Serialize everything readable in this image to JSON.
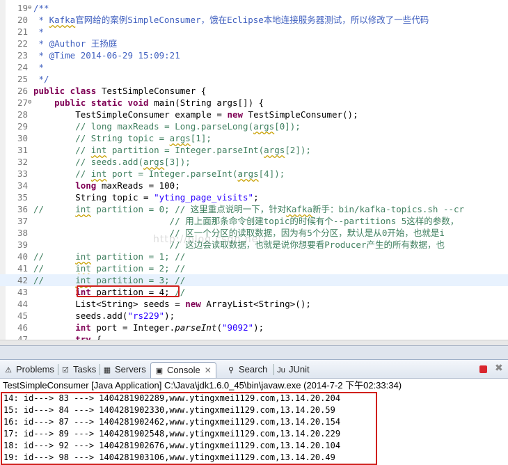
{
  "editor": {
    "lines": [
      {
        "n": "19",
        "marker": "⊖",
        "segs": [
          {
            "t": "/**",
            "c": "jd"
          }
        ]
      },
      {
        "n": "20",
        "segs": [
          {
            "t": " * ",
            "c": "jd"
          },
          {
            "t": "Kafka",
            "c": "jd sq"
          },
          {
            "t": "官网给的案例",
            "c": "jd cjk"
          },
          {
            "t": "SimpleConsumer",
            "c": "jd"
          },
          {
            "t": "，饿在",
            "c": "jd cjk"
          },
          {
            "t": "Eclipse",
            "c": "jd"
          },
          {
            "t": "本地连接服务器测试，所以修改了一些代码",
            "c": "jd cjk"
          }
        ]
      },
      {
        "n": "21",
        "segs": [
          {
            "t": " *",
            "c": "jd"
          }
        ]
      },
      {
        "n": "22",
        "segs": [
          {
            "t": " * @Author ",
            "c": "jd"
          },
          {
            "t": "王扬庭",
            "c": "jd cjk"
          }
        ]
      },
      {
        "n": "23",
        "segs": [
          {
            "t": " * @Time 2014-06-29 15:09:21",
            "c": "jd"
          }
        ]
      },
      {
        "n": "24",
        "segs": [
          {
            "t": " *",
            "c": "jd"
          }
        ]
      },
      {
        "n": "25",
        "segs": [
          {
            "t": " */",
            "c": "jd"
          }
        ]
      },
      {
        "n": "26",
        "segs": [
          {
            "t": "public class",
            "c": "kw"
          },
          {
            "t": " TestSimpleConsumer {",
            "c": ""
          }
        ]
      },
      {
        "n": "27",
        "marker": "⊖",
        "segs": [
          {
            "t": "    ",
            "c": ""
          },
          {
            "t": "public static void",
            "c": "kw"
          },
          {
            "t": " main(String args[]) {",
            "c": ""
          }
        ]
      },
      {
        "n": "28",
        "segs": [
          {
            "t": "        TestSimpleConsumer example = ",
            "c": ""
          },
          {
            "t": "new",
            "c": "kw"
          },
          {
            "t": " TestSimpleConsumer();",
            "c": ""
          }
        ]
      },
      {
        "n": "29",
        "segs": [
          {
            "t": "        // long maxReads = Long.parseLong(",
            "c": "cm"
          },
          {
            "t": "args",
            "c": "cm sq"
          },
          {
            "t": "[0]);",
            "c": "cm"
          }
        ]
      },
      {
        "n": "30",
        "segs": [
          {
            "t": "        // String topic = ",
            "c": "cm"
          },
          {
            "t": "args",
            "c": "cm sq"
          },
          {
            "t": "[1];",
            "c": "cm"
          }
        ]
      },
      {
        "n": "31",
        "segs": [
          {
            "t": "        // ",
            "c": "cm"
          },
          {
            "t": "int",
            "c": "cm sq"
          },
          {
            "t": " partition = Integer.parseInt(",
            "c": "cm"
          },
          {
            "t": "args",
            "c": "cm sq"
          },
          {
            "t": "[2]);",
            "c": "cm"
          }
        ]
      },
      {
        "n": "32",
        "segs": [
          {
            "t": "        // seeds.add(",
            "c": "cm"
          },
          {
            "t": "args",
            "c": "cm sq"
          },
          {
            "t": "[3]);",
            "c": "cm"
          }
        ]
      },
      {
        "n": "33",
        "segs": [
          {
            "t": "        // ",
            "c": "cm"
          },
          {
            "t": "int",
            "c": "cm sq"
          },
          {
            "t": " port = Integer.parseInt(",
            "c": "cm"
          },
          {
            "t": "args",
            "c": "cm sq"
          },
          {
            "t": "[4]);",
            "c": "cm"
          }
        ]
      },
      {
        "n": "34",
        "segs": [
          {
            "t": "        ",
            "c": ""
          },
          {
            "t": "long",
            "c": "kw"
          },
          {
            "t": " maxReads = 100;",
            "c": ""
          }
        ]
      },
      {
        "n": "35",
        "segs": [
          {
            "t": "        String topic = ",
            "c": ""
          },
          {
            "t": "\"yting_page_visits\"",
            "c": "st"
          },
          {
            "t": ";",
            "c": ""
          }
        ]
      },
      {
        "n": "36",
        "segs": [
          {
            "t": "//      ",
            "c": "cm"
          },
          {
            "t": "int",
            "c": "cm sq"
          },
          {
            "t": " partition = 0; // ",
            "c": "cm"
          },
          {
            "t": "这里重点说明一下，针对",
            "c": "cm cjk"
          },
          {
            "t": "Kafka",
            "c": "cm sq"
          },
          {
            "t": "新手：",
            "c": "cm cjk"
          },
          {
            "t": "bin/kafka-topics.sh --cr",
            "c": "cm"
          }
        ]
      },
      {
        "n": "37",
        "segs": [
          {
            "t": "                          // ",
            "c": "cm"
          },
          {
            "t": "用上面那条命令创建",
            "c": "cm cjk"
          },
          {
            "t": "topic",
            "c": "cm"
          },
          {
            "t": "的时候有个",
            "c": "cm cjk"
          },
          {
            "t": "--partitions 5",
            "c": "cm"
          },
          {
            "t": "这样的参数，",
            "c": "cm cjk"
          }
        ]
      },
      {
        "n": "38",
        "segs": [
          {
            "t": "                          // ",
            "c": "cm"
          },
          {
            "t": "区一个分区的读取数据，因为有",
            "c": "cm cjk"
          },
          {
            "t": "5",
            "c": "cm"
          },
          {
            "t": "个分区，默认是从",
            "c": "cm cjk"
          },
          {
            "t": "0",
            "c": "cm"
          },
          {
            "t": "开始，也就是",
            "c": "cm cjk"
          },
          {
            "t": "i",
            "c": "cm"
          }
        ]
      },
      {
        "n": "39",
        "segs": [
          {
            "t": "                          // ",
            "c": "cm"
          },
          {
            "t": "这边会读取数据，也就是说你想要看",
            "c": "cm cjk"
          },
          {
            "t": "Producer",
            "c": "cm"
          },
          {
            "t": "产生的所有数据，也",
            "c": "cm cjk"
          }
        ]
      },
      {
        "n": "40",
        "segs": [
          {
            "t": "//      ",
            "c": "cm"
          },
          {
            "t": "int",
            "c": "cm sq"
          },
          {
            "t": " partition = 1; //",
            "c": "cm"
          }
        ]
      },
      {
        "n": "41",
        "segs": [
          {
            "t": "//      ",
            "c": "cm"
          },
          {
            "t": "int",
            "c": "cm sq"
          },
          {
            "t": " partition = 2; //",
            "c": "cm"
          }
        ]
      },
      {
        "n": "42",
        "current": true,
        "segs": [
          {
            "t": "//      ",
            "c": "cm"
          },
          {
            "t": "int",
            "c": "cm sq"
          },
          {
            "t": " partition = 3; //",
            "c": "cm"
          }
        ]
      },
      {
        "n": "43",
        "segs": [
          {
            "t": "        ",
            "c": ""
          },
          {
            "t": "int",
            "c": "kw"
          },
          {
            "t": " partition = 4; ",
            "c": ""
          },
          {
            "t": "//",
            "c": "cm"
          }
        ]
      },
      {
        "n": "44",
        "segs": [
          {
            "t": "        List<String> seeds = ",
            "c": ""
          },
          {
            "t": "new",
            "c": "kw"
          },
          {
            "t": " ArrayList<String>();",
            "c": ""
          }
        ]
      },
      {
        "n": "45",
        "segs": [
          {
            "t": "        seeds.add(",
            "c": ""
          },
          {
            "t": "\"rs229\"",
            "c": "st"
          },
          {
            "t": ");",
            "c": ""
          }
        ]
      },
      {
        "n": "46",
        "segs": [
          {
            "t": "        ",
            "c": ""
          },
          {
            "t": "int",
            "c": "kw"
          },
          {
            "t": " port = Integer.",
            "c": ""
          },
          {
            "t": "parseInt",
            "c": "it"
          },
          {
            "t": "(",
            "c": ""
          },
          {
            "t": "\"9092\"",
            "c": "st"
          },
          {
            "t": ");",
            "c": ""
          }
        ]
      },
      {
        "n": "47",
        "segs": [
          {
            "t": "        ",
            "c": ""
          },
          {
            "t": "try",
            "c": "kw"
          },
          {
            "t": " {",
            "c": ""
          }
        ]
      }
    ],
    "watermark": "http://blog.csdn.net/"
  },
  "view": {
    "tabs": [
      {
        "name": "tab-problems",
        "icon": "problems-icon",
        "glyph": "⚠",
        "label": "Problems"
      },
      {
        "name": "tab-tasks",
        "icon": "tasks-icon",
        "glyph": "☑",
        "label": "Tasks"
      },
      {
        "name": "tab-servers",
        "icon": "servers-icon",
        "glyph": "▦",
        "label": "Servers"
      },
      {
        "name": "tab-console",
        "icon": "console-icon",
        "glyph": "▣",
        "label": "Console",
        "active": true
      },
      {
        "name": "tab-search",
        "icon": "search-icon",
        "glyph": "⚲",
        "label": "Search"
      },
      {
        "name": "tab-junit",
        "icon": "junit-icon",
        "glyph": "Ju",
        "label": "JUnit"
      }
    ],
    "close_glyph": "✕",
    "remove_glyph": "✖",
    "process_line": "TestSimpleConsumer [Java Application] C:\\Java\\jdk1.6.0_45\\bin\\javaw.exe (2014-7-2 下午02:33:34)",
    "output": [
      "14: id---> 83 ---> 1404281902289,www.ytingxmei1129.com,13.14.20.204",
      "15: id---> 84 ---> 1404281902330,www.ytingxmei1129.com,13.14.20.59",
      "16: id---> 87 ---> 1404281902462,www.ytingxmei1129.com,13.14.20.154",
      "17: id---> 89 ---> 1404281902548,www.ytingxmei1129.com,13.14.20.229",
      "18: id---> 92 ---> 1404281902676,www.ytingxmei1129.com,13.14.20.104",
      "19: id---> 98 ---> 1404281903106,www.ytingxmei1129.com,13.14.20.49"
    ]
  },
  "colors": {
    "keyword": "#7f0055",
    "comment": "#3f7f5f",
    "javadoc": "#3f5fbf",
    "string": "#2a00ff",
    "highlight_box": "#d0201c"
  }
}
